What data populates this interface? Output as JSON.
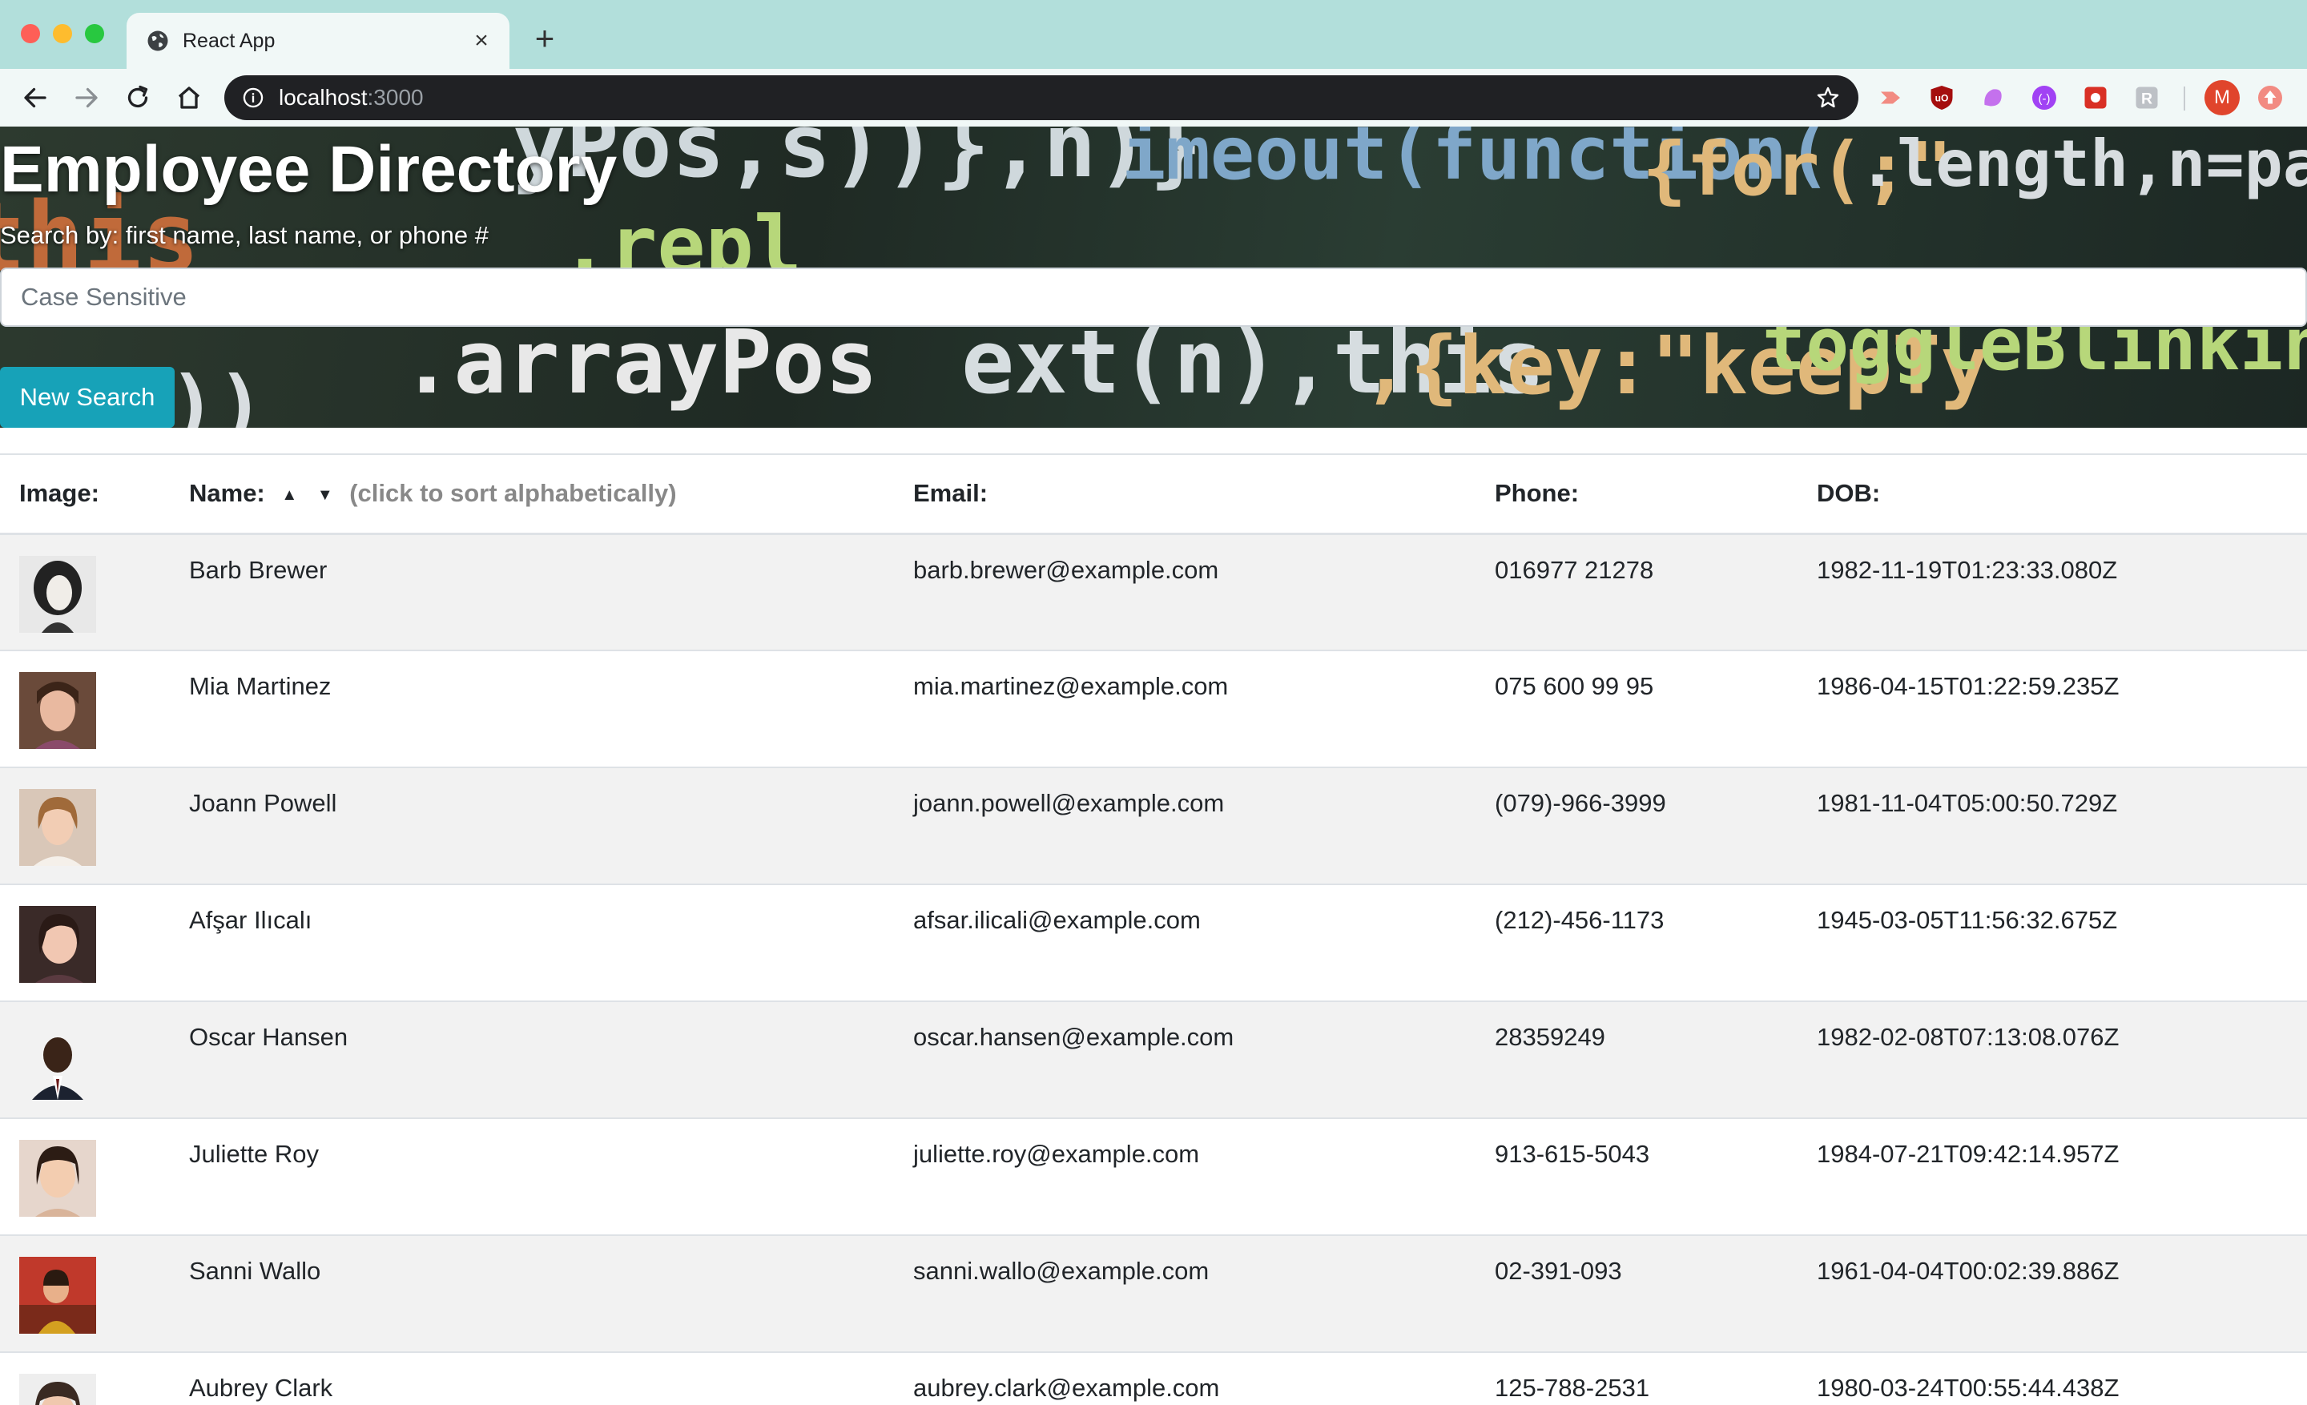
{
  "browser": {
    "tab_title": "React App",
    "url_host": "localhost",
    "url_port": ":3000",
    "profile_initial": "M"
  },
  "hero": {
    "title": "Employee Directory",
    "subtitle": "Search by: first name, last name, or phone #",
    "search_placeholder": "Case Sensitive",
    "search_value": "",
    "button_label": "New Search"
  },
  "table": {
    "headers": {
      "image": "Image:",
      "name": "Name:",
      "name_hint": "(click to sort alphabetically)",
      "email": "Email:",
      "phone": "Phone:",
      "dob": "DOB:"
    },
    "rows": [
      {
        "name": "Barb Brewer",
        "email": "barb.brewer@example.com",
        "phone": "016977 21278",
        "dob": "1982-11-19T01:23:33.080Z"
      },
      {
        "name": "Mia Martinez",
        "email": "mia.martinez@example.com",
        "phone": "075 600 99 95",
        "dob": "1986-04-15T01:22:59.235Z"
      },
      {
        "name": "Joann Powell",
        "email": "joann.powell@example.com",
        "phone": "(079)-966-3999",
        "dob": "1981-11-04T05:00:50.729Z"
      },
      {
        "name": "Afşar Ilıcalı",
        "email": "afsar.ilicali@example.com",
        "phone": "(212)-456-1173",
        "dob": "1945-03-05T11:56:32.675Z"
      },
      {
        "name": "Oscar Hansen",
        "email": "oscar.hansen@example.com",
        "phone": "28359249",
        "dob": "1982-02-08T07:13:08.076Z"
      },
      {
        "name": "Juliette Roy",
        "email": "juliette.roy@example.com",
        "phone": "913-615-5043",
        "dob": "1984-07-21T09:42:14.957Z"
      },
      {
        "name": "Sanni Wallo",
        "email": "sanni.wallo@example.com",
        "phone": "02-391-093",
        "dob": "1961-04-04T00:02:39.886Z"
      },
      {
        "name": "Aubrey Clark",
        "email": "aubrey.clark@example.com",
        "phone": "125-788-2531",
        "dob": "1980-03-24T00:55:44.438Z"
      }
    ]
  },
  "colors": {
    "chrome_bg": "#b2dfdb",
    "button_bg": "#17a2b8",
    "stripe": "#f2f2f2"
  }
}
